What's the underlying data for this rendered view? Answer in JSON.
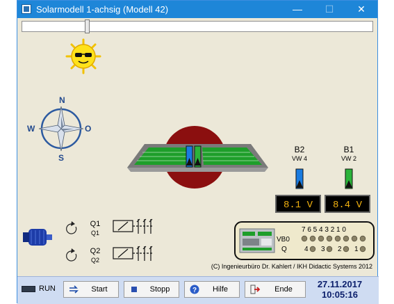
{
  "window": {
    "title": "Solarmodell 1-achsig (Modell 42)"
  },
  "controls": {
    "min_glyph": "—",
    "max_glyph": "☐",
    "close_glyph": "✕"
  },
  "compass": {
    "n": "N",
    "s": "S",
    "w": "W",
    "o": "O"
  },
  "sensors": [
    {
      "name": "B2",
      "address": "VW 4",
      "display": "8.1 V",
      "color": "#1a7be0"
    },
    {
      "name": "B1",
      "address": "VW 2",
      "display": "8.4 V",
      "color": "#2bb33a"
    }
  ],
  "outputs": [
    {
      "label": "Q1",
      "sublabel": "Q1"
    },
    {
      "label": "Q2",
      "sublabel": "Q2"
    }
  ],
  "plc": {
    "bit_header": "7 6 5 4 3 2 1 0",
    "vb0_label": "VB0",
    "q_label": "Q",
    "q_bits": [
      "4",
      "3",
      "2",
      "1"
    ]
  },
  "copyright": "(C) Ingenieurbüro Dr. Kahlert / IKH Didactic Systems 2012",
  "buttons": {
    "run": "RUN",
    "start": "Start",
    "stopp": "Stopp",
    "hilfe": "Hilfe",
    "ende": "Ende"
  },
  "status": {
    "date": "27.11.2017",
    "time": "10:05:16"
  },
  "colors": {
    "titlebar": "#1e86d8",
    "panel_green": "#1e9e2a",
    "lcd_text": "#f0b010",
    "base_red": "#8b0f0f"
  }
}
